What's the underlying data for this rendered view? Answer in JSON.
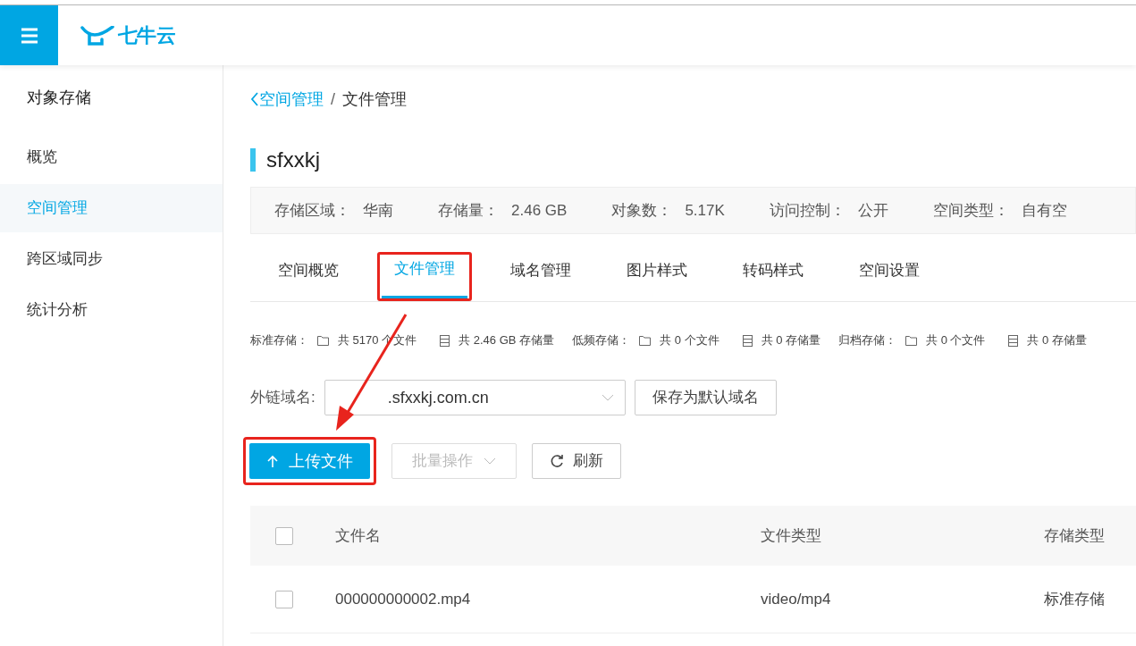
{
  "header": {
    "logo_text": "七牛云"
  },
  "sidebar": {
    "title": "对象存储",
    "items": [
      {
        "label": "概览",
        "selected": false
      },
      {
        "label": "空间管理",
        "selected": true
      },
      {
        "label": "跨区域同步",
        "selected": false
      },
      {
        "label": "统计分析",
        "selected": false
      }
    ]
  },
  "breadcrumb": {
    "parent": "空间管理",
    "separator": "/",
    "current": "文件管理"
  },
  "bucket": {
    "name": "sfxxkj",
    "info": [
      {
        "label": "存储区域：",
        "value": "华南"
      },
      {
        "label": "存储量：",
        "value": "2.46 GB"
      },
      {
        "label": "对象数：",
        "value": "5.17K"
      },
      {
        "label": "访问控制：",
        "value": "公开"
      },
      {
        "label": "空间类型：",
        "value": "自有空"
      }
    ]
  },
  "tabs": [
    {
      "label": "空间概览",
      "selected": false,
      "highlighted": false
    },
    {
      "label": "文件管理",
      "selected": true,
      "highlighted": true
    },
    {
      "label": "域名管理",
      "selected": false,
      "highlighted": false
    },
    {
      "label": "图片样式",
      "selected": false,
      "highlighted": false
    },
    {
      "label": "转码样式",
      "selected": false,
      "highlighted": false
    },
    {
      "label": "空间设置",
      "selected": false,
      "highlighted": false
    }
  ],
  "storage_stats": [
    {
      "label": "标准存储：",
      "files": "共 5170 个文件",
      "size": "共 2.46 GB 存储量"
    },
    {
      "label": "低频存储：",
      "files": "共 0 个文件",
      "size": "共 0 存储量"
    },
    {
      "label": "归档存储：",
      "files": "共 0 个文件",
      "size": "共 0 存储量"
    }
  ],
  "domain": {
    "label": "外链域名:",
    "value": ".sfxxkj.com.cn",
    "save_button": "保存为默认域名"
  },
  "actions": {
    "upload": {
      "label": "上传文件",
      "highlighted": true
    },
    "batch": {
      "label": "批量操作",
      "disabled": true
    },
    "refresh": {
      "label": "刷新"
    }
  },
  "table": {
    "columns": [
      "文件名",
      "文件类型",
      "存储类型"
    ],
    "select_all": false,
    "rows": [
      {
        "checked": false,
        "cells": [
          "000000000002.mp4",
          "video/mp4",
          "标准存储"
        ]
      }
    ]
  }
}
